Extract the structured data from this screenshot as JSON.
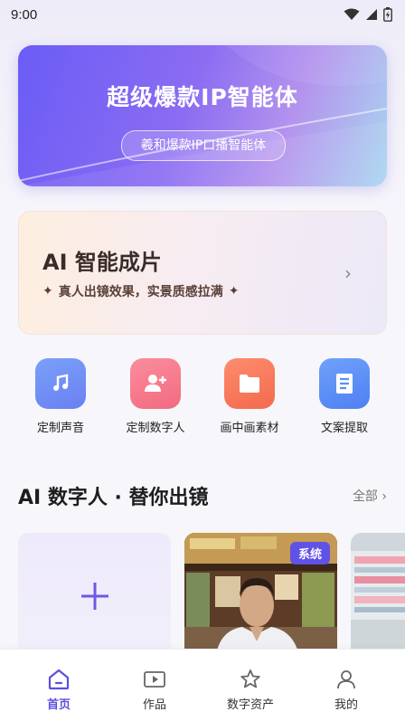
{
  "status_bar": {
    "time": "9:00"
  },
  "hero": {
    "title": "超级爆款IP智能体",
    "pill": "羲和爆款IP口播智能体"
  },
  "ai_card": {
    "title": "AI 智能成片",
    "subtitle": "真人出镜效果，实景质感拉满"
  },
  "tools": [
    {
      "label": "定制声音",
      "icon": "music-note-icon",
      "color": "#6f8ff5"
    },
    {
      "label": "定制数字人",
      "icon": "add-person-icon",
      "color": "#f77a8e"
    },
    {
      "label": "画中画素材",
      "icon": "folder-icon",
      "color": "#f9795e"
    },
    {
      "label": "文案提取",
      "icon": "document-icon",
      "color": "#5b8ef7"
    }
  ],
  "section": {
    "title": "AI 数字人 · 替你出镜",
    "more": "全部 ›"
  },
  "cards": {
    "badge": "系统"
  },
  "tabbar": {
    "items": [
      {
        "label": "首页",
        "icon": "home-icon",
        "active": true
      },
      {
        "label": "作品",
        "icon": "video-play-icon",
        "active": false
      },
      {
        "label": "数字资产",
        "icon": "star-icon",
        "active": false
      },
      {
        "label": "我的",
        "icon": "person-icon",
        "active": false
      }
    ]
  },
  "colors": {
    "accent": "#5b4fe0"
  }
}
